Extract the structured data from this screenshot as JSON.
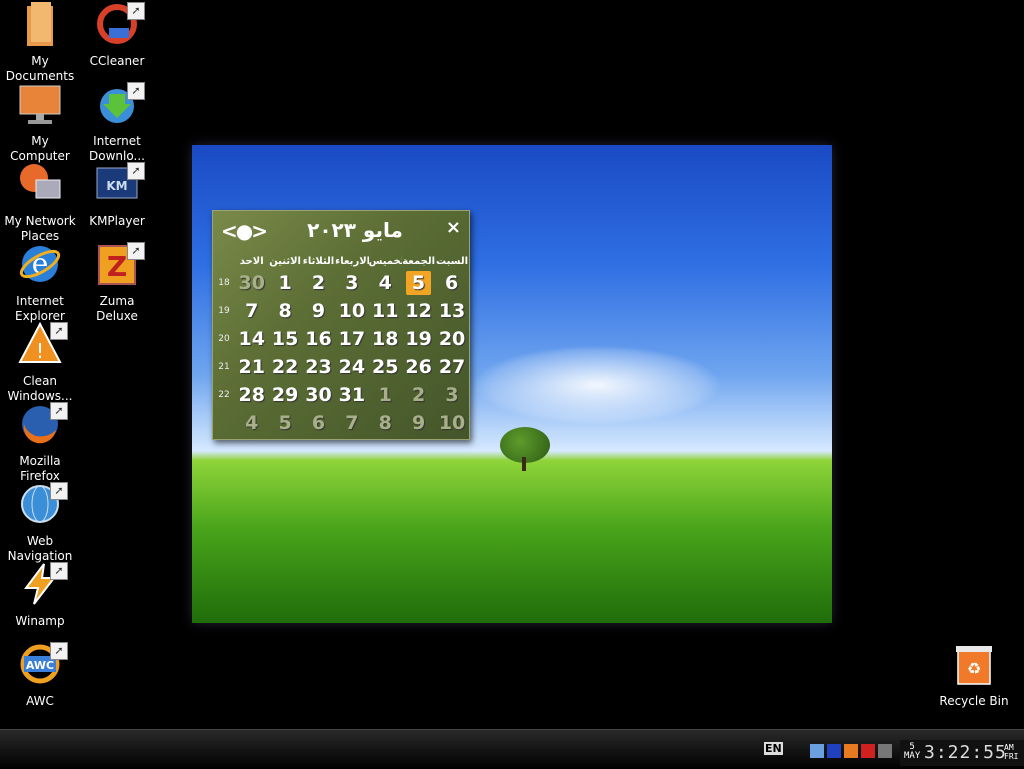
{
  "desktop_icons_col1": [
    {
      "name": "my-documents",
      "label": "My Documents",
      "glyph": "📁",
      "shortcut": false
    },
    {
      "name": "my-computer",
      "label": "My Computer",
      "glyph": "🖥",
      "shortcut": false
    },
    {
      "name": "my-network-places",
      "label": "My Network Places",
      "glyph": "🖧",
      "shortcut": false
    },
    {
      "name": "internet-explorer",
      "label": "Internet Explorer",
      "glyph": "e",
      "shortcut": false
    },
    {
      "name": "clean-windows",
      "label": "Clean Windows...",
      "glyph": "⚠",
      "shortcut": true
    },
    {
      "name": "mozilla-firefox",
      "label": "Mozilla Firefox",
      "glyph": "🦊",
      "shortcut": true
    },
    {
      "name": "web-navigation",
      "label": "Web Navigation",
      "glyph": "🌐",
      "shortcut": true
    },
    {
      "name": "winamp",
      "label": "Winamp",
      "glyph": "⚡",
      "shortcut": true
    },
    {
      "name": "awc",
      "label": "AWC",
      "glyph": "AWC",
      "shortcut": true
    }
  ],
  "desktop_icons_col2": [
    {
      "name": "ccleaner",
      "label": "CCleaner",
      "glyph": "C",
      "shortcut": true
    },
    {
      "name": "internet-download-manager",
      "label": "Internet Downlo...",
      "glyph": "⬇",
      "shortcut": true
    },
    {
      "name": "kmplayer",
      "label": "KMPlayer",
      "glyph": "KM",
      "shortcut": true
    },
    {
      "name": "zuma-deluxe",
      "label": "Zuma Deluxe",
      "glyph": "Z",
      "shortcut": true
    }
  ],
  "recycle_bin": {
    "label": "Recycle Bin",
    "glyph": "♻"
  },
  "calendar": {
    "title": "مايو ٢٠٢٣",
    "nav_symbol": "<●>",
    "close_symbol": "×",
    "weekdays": [
      "الاحد",
      "الاثنين",
      "الثلاثاء",
      "الاربعاء",
      "الخميس",
      "الجمعة",
      "السبت"
    ],
    "weeks": [
      {
        "num": "18",
        "days": [
          "30",
          "1",
          "2",
          "3",
          "4",
          "5",
          "6"
        ]
      },
      {
        "num": "19",
        "days": [
          "7",
          "8",
          "9",
          "10",
          "11",
          "12",
          "13"
        ]
      },
      {
        "num": "20",
        "days": [
          "14",
          "15",
          "16",
          "17",
          "18",
          "19",
          "20"
        ]
      },
      {
        "num": "21",
        "days": [
          "21",
          "22",
          "23",
          "24",
          "25",
          "26",
          "27"
        ]
      },
      {
        "num": "22",
        "days": [
          "28",
          "29",
          "30",
          "31",
          "1",
          "2",
          "3"
        ]
      },
      {
        "num": "",
        "days": [
          "4",
          "5",
          "6",
          "7",
          "8",
          "9",
          "10"
        ]
      }
    ]
  },
  "taskbar": {
    "language": "EN",
    "clock": {
      "day": "5",
      "month": "MAY",
      "time": "3:22:55",
      "ampm": "AM",
      "weekday": "FRI"
    }
  }
}
